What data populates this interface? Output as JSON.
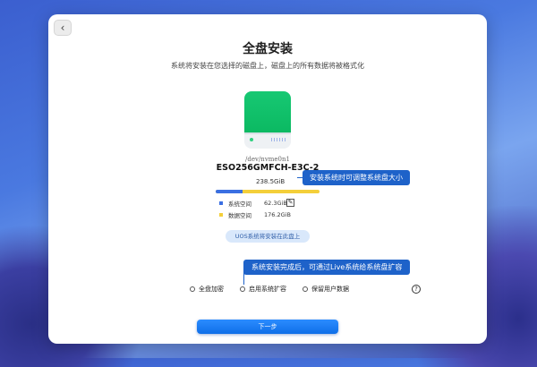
{
  "dialog": {
    "title": "全盘安装",
    "subtitle": "系统将安装在您选择的磁盘上，磁盘上的所有数据将被格式化"
  },
  "disk": {
    "device_path": "/dev/nvme0n1",
    "model": "ESO256GMFCH-E3C-2",
    "total_size": "238.5GiB",
    "usage": {
      "system_fraction": 0.26,
      "system_color": "#3a6fe2",
      "data_color": "#f4cf3a"
    },
    "legend": [
      {
        "label": "系统空间",
        "value": "62.3GiB"
      },
      {
        "label": "数据空间",
        "value": "176.2GiB"
      }
    ]
  },
  "tooltips": {
    "resize": "安装系统时可调整系统盘大小",
    "expand": "系统安装完成后，可通过Live系统给系统盘扩容"
  },
  "uos_note": "UOS系统将安装在此盘上",
  "options": [
    {
      "label": "全盘加密"
    },
    {
      "label": "启用系统扩容"
    },
    {
      "label": "保留用户数据"
    }
  ],
  "buttons": {
    "next": "下一步",
    "back_icon": "‹",
    "help_icon": "?"
  },
  "colors": {
    "accent": "#1e62c9",
    "disk_green": "#07b45c"
  }
}
